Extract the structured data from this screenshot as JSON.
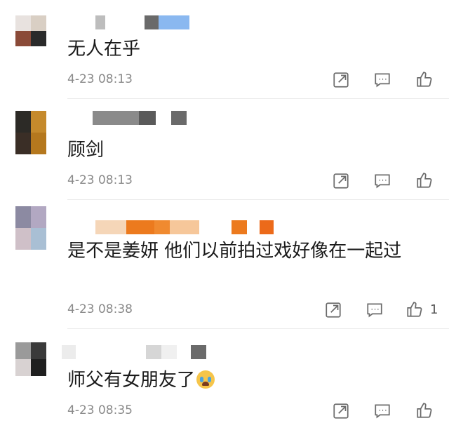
{
  "comments": [
    {
      "text": "无人在乎",
      "time": "4-23 08:13",
      "like_count": "",
      "avatar_colors": [
        "#e8e2df",
        "#d9cfc4",
        "#8a4a38",
        "#2a2a2a"
      ]
    },
    {
      "text": "顾剑",
      "time": "4-23 08:13",
      "like_count": "",
      "avatar_colors": [
        "#2c2a26",
        "#c58a2c",
        "#3a2e26",
        "#b5781e"
      ]
    },
    {
      "text": "是不是姜妍 他们以前拍过戏好像在一起过",
      "time": "4-23 08:38",
      "like_count": "1",
      "avatar_colors": [
        "#8c8aa2",
        "#b2a8c2",
        "#cfc0c8",
        "#a9bfd4"
      ]
    },
    {
      "text": "师父有女朋友了",
      "time": "4-23 08:35",
      "like_count": "",
      "avatar_colors": [
        "#9a9a9a",
        "#3a3a3a",
        "#d8d2d2",
        "#1f1f1f"
      ]
    }
  ],
  "icons": {
    "share": "share-icon",
    "reply": "comment-icon",
    "like": "thumbs-up-icon",
    "emoji": "crying-face-emoji"
  }
}
